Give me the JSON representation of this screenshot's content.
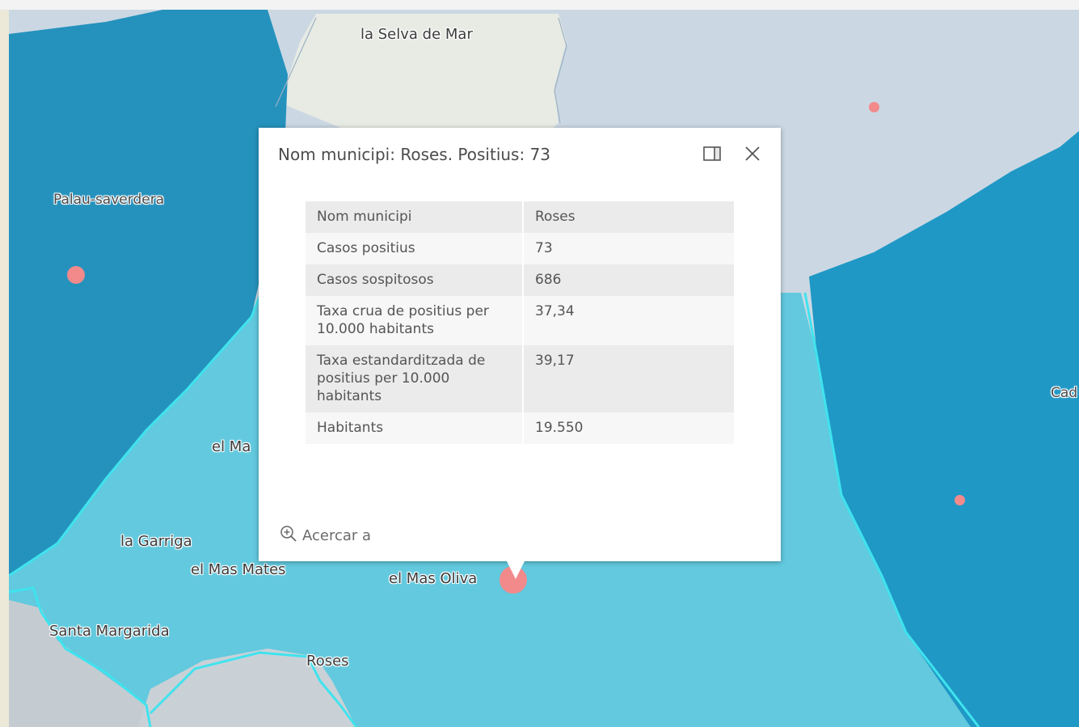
{
  "popup": {
    "title": "Nom municipi: Roses. Positius: 73",
    "dock_icon": "dock-side-icon",
    "close_icon": "close-icon",
    "rows": [
      {
        "label": "Nom municipi",
        "value": "Roses"
      },
      {
        "label": "Casos positius",
        "value": "73"
      },
      {
        "label": "Casos sospitosos",
        "value": "686"
      },
      {
        "label": "Taxa crua de positius per 10.000 habitants",
        "value": "37,34"
      },
      {
        "label": "Taxa estandarditzada de positius per 10.000 habitants",
        "value": "39,17"
      },
      {
        "label": "Habitants",
        "value": "19.550"
      }
    ],
    "zoom_label": "Acercar a",
    "zoom_icon": "zoom-in-icon"
  },
  "map": {
    "labels": {
      "selva": "la Selva de Mar",
      "palau": "Palau-saverdera",
      "mas_partial": "el Ma",
      "garriga": "la Garriga",
      "mas_mates": "el Mas Mates",
      "mas_oliva": "el Mas Oliva",
      "santa_margarida": "Santa Margarida",
      "roses": "Roses",
      "cad_partial": "Cad"
    },
    "colors": {
      "deep_blue": "#2592bd",
      "light_blue": "#5ec6dc",
      "sea_gray": "#cbd8e3",
      "land_light": "#e9ede7",
      "boundary_cyan": "#3fe3ee",
      "marker": "#f28a8c"
    }
  }
}
